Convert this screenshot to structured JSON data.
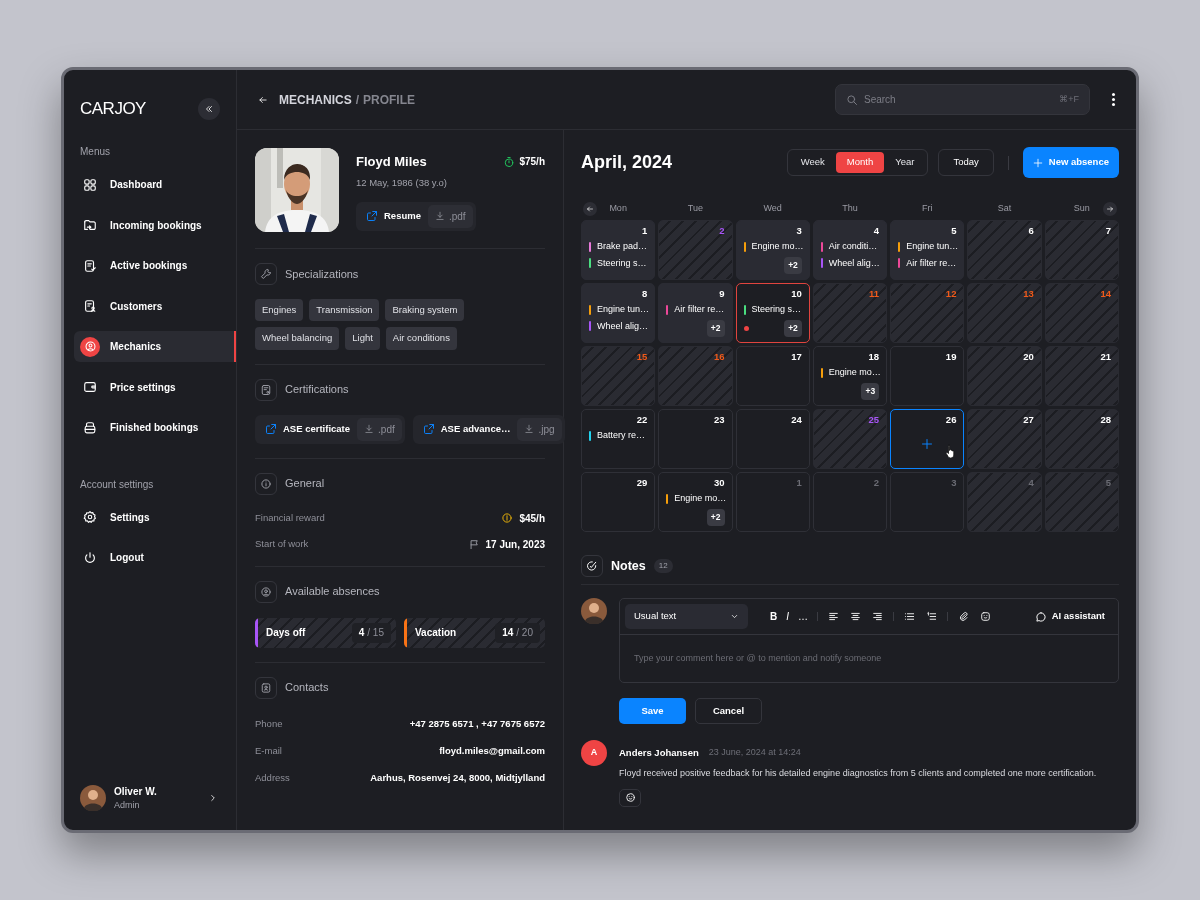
{
  "brand": "CARJOY",
  "sidebar": {
    "sections": [
      {
        "title": "Menus",
        "items": [
          {
            "label": "Dashboard",
            "selected": false
          },
          {
            "label": "Incoming bookings",
            "selected": false
          },
          {
            "label": "Active bookings",
            "selected": false
          },
          {
            "label": "Customers",
            "selected": false
          },
          {
            "label": "Mechanics",
            "selected": true
          },
          {
            "label": "Price settings",
            "selected": false
          },
          {
            "label": "Finished bookings",
            "selected": false
          }
        ]
      },
      {
        "title": "Account settings",
        "items": [
          {
            "label": "Settings",
            "selected": false
          },
          {
            "label": "Logout",
            "selected": false
          }
        ]
      }
    ],
    "user": {
      "name": "Oliver W.",
      "role": "Admin"
    }
  },
  "breadcrumb": {
    "parent": "MECHANICS",
    "separator": "/",
    "current": "PROFILE"
  },
  "search": {
    "placeholder": "Search",
    "shortcut": "⌘+F"
  },
  "profile": {
    "name": "Floyd Miles",
    "birth": "12 May, 1986 (38 y.o)",
    "rate": "$75/h",
    "resume": {
      "label": "Resume",
      "file": ".pdf"
    }
  },
  "specializations": {
    "title": "Specializations",
    "tags": [
      "Engines",
      "Transmission",
      "Braking system",
      "Wheel balancing",
      "Light",
      "Air conditions"
    ]
  },
  "certifications": {
    "title": "Certifications",
    "files": [
      {
        "label": "ASE certificate",
        "file": ".pdf"
      },
      {
        "label": "ASE advance…",
        "file": ".jpg"
      }
    ]
  },
  "general": {
    "title": "General",
    "rows": [
      {
        "kind": "reward",
        "label": "Financial reward",
        "value": "$45/h"
      },
      {
        "kind": "date",
        "label": "Start of work",
        "value": "17 Jun, 2023"
      }
    ]
  },
  "absences": {
    "title": "Available absences",
    "items": [
      {
        "label": "Days off",
        "used": "4",
        "total": "/ 15",
        "color": "#a855f7"
      },
      {
        "label": "Vacation",
        "used": "14",
        "total": "/ 20",
        "color": "#f97316"
      }
    ]
  },
  "contacts": {
    "title": "Contacts",
    "rows": [
      {
        "label": "Phone",
        "value": "+47 2875 6571 , +47 7675 6572"
      },
      {
        "label": "E-mail",
        "value": "floyd.miles@gmail.com"
      },
      {
        "label": "Address",
        "value": "Aarhus, Rosenvej 24, 8000, Midtjylland"
      }
    ]
  },
  "calendar": {
    "title": "April, 2024",
    "views": [
      {
        "label": "Week",
        "selected": false
      },
      {
        "label": "Month",
        "selected": true
      },
      {
        "label": "Year",
        "selected": false
      }
    ],
    "today": "Today",
    "new_button": "New absence",
    "weekdays": [
      "Mon",
      "Tue",
      "Wed",
      "Thu",
      "Fri",
      "Sat",
      "Sun"
    ],
    "days": [
      {
        "number": "1",
        "kind": "busy",
        "color": "#ffffff",
        "today": false,
        "hovered": false,
        "events": [
          {
            "title": "Brake pad…",
            "color": "#e879d9"
          },
          {
            "title": "Steering s…",
            "color": "#4ade80"
          }
        ]
      },
      {
        "number": "2",
        "kind": "off",
        "color": "#a855f7",
        "today": false,
        "hovered": false
      },
      {
        "number": "3",
        "kind": "busy",
        "color": "#ffffff",
        "today": false,
        "hovered": false,
        "events": [
          {
            "title": "Engine mo…",
            "color": "#f59e0b"
          }
        ],
        "more": "+2"
      },
      {
        "number": "4",
        "kind": "busy",
        "color": "#ffffff",
        "today": false,
        "hovered": false,
        "events": [
          {
            "title": "Air conditi…",
            "color": "#ec4899"
          },
          {
            "title": "Wheel alig…",
            "color": "#a855f7"
          }
        ]
      },
      {
        "number": "5",
        "kind": "busy",
        "color": "#ffffff",
        "today": false,
        "hovered": false,
        "events": [
          {
            "title": "Engine tun…",
            "color": "#f59e0b"
          },
          {
            "title": "Air filter re…",
            "color": "#ec4899"
          }
        ]
      },
      {
        "number": "6",
        "kind": "off",
        "color": "#ffffff",
        "today": false,
        "hovered": false
      },
      {
        "number": "7",
        "kind": "off",
        "color": "#ffffff",
        "today": false,
        "hovered": false
      },
      {
        "number": "8",
        "kind": "busy",
        "color": "#ffffff",
        "today": false,
        "hovered": false,
        "events": [
          {
            "title": "Engine tun…",
            "color": "#f59e0b"
          },
          {
            "title": "Wheel alig…",
            "color": "#a855f7"
          }
        ]
      },
      {
        "number": "9",
        "kind": "busy",
        "color": "#ffffff",
        "today": false,
        "hovered": false,
        "events": [
          {
            "title": "Air filter re…",
            "color": "#ec4899"
          }
        ],
        "more": "+2"
      },
      {
        "number": "10",
        "kind": "free",
        "color": "#ffffff",
        "today": true,
        "hovered": false,
        "events": [
          {
            "title": "Steering s…",
            "color": "#4ade80"
          }
        ],
        "more": "+2"
      },
      {
        "number": "11",
        "kind": "off",
        "color": "#f05a1a",
        "today": false,
        "hovered": false
      },
      {
        "number": "12",
        "kind": "off",
        "color": "#f05a1a",
        "today": false,
        "hovered": false
      },
      {
        "number": "13",
        "kind": "off",
        "color": "#f05a1a",
        "today": false,
        "hovered": false
      },
      {
        "number": "14",
        "kind": "off",
        "color": "#f05a1a",
        "today": false,
        "hovered": false
      },
      {
        "number": "15",
        "kind": "off",
        "color": "#f05a1a",
        "today": false,
        "hovered": false
      },
      {
        "number": "16",
        "kind": "off",
        "color": "#f05a1a",
        "today": false,
        "hovered": false
      },
      {
        "number": "17",
        "kind": "free",
        "color": "#ffffff",
        "today": false,
        "hovered": false
      },
      {
        "number": "18",
        "kind": "free",
        "color": "#ffffff",
        "today": false,
        "hovered": false,
        "events": [
          {
            "title": "Engine mo…",
            "color": "#f59e0b"
          }
        ],
        "more": "+3"
      },
      {
        "number": "19",
        "kind": "free",
        "color": "#ffffff",
        "today": false,
        "hovered": false
      },
      {
        "number": "20",
        "kind": "off",
        "color": "#ffffff",
        "today": false,
        "hovered": false
      },
      {
        "number": "21",
        "kind": "off",
        "color": "#ffffff",
        "today": false,
        "hovered": false
      },
      {
        "number": "22",
        "kind": "free",
        "color": "#ffffff",
        "today": false,
        "hovered": false,
        "events": [
          {
            "title": "Battery re…",
            "color": "#22d3ee"
          }
        ]
      },
      {
        "number": "23",
        "kind": "free",
        "color": "#ffffff",
        "today": false,
        "hovered": false
      },
      {
        "number": "24",
        "kind": "free",
        "color": "#ffffff",
        "today": false,
        "hovered": false
      },
      {
        "number": "25",
        "kind": "off",
        "color": "#a855f7",
        "today": false,
        "hovered": false
      },
      {
        "number": "26",
        "kind": "free",
        "color": "#ffffff",
        "today": false,
        "hovered": true
      },
      {
        "number": "27",
        "kind": "off",
        "color": "#ffffff",
        "today": false,
        "hovered": false
      },
      {
        "number": "28",
        "kind": "off",
        "color": "#ffffff",
        "today": false,
        "hovered": false
      },
      {
        "number": "29",
        "kind": "free",
        "color": "#ffffff",
        "today": false,
        "hovered": false
      },
      {
        "number": "30",
        "kind": "free",
        "color": "#ffffff",
        "today": false,
        "hovered": false,
        "events": [
          {
            "title": "Engine mo…",
            "color": "#f59e0b"
          }
        ],
        "more": "+2"
      },
      {
        "number": "1",
        "kind": "free",
        "color": "#6b6c74",
        "today": false,
        "hovered": false
      },
      {
        "number": "2",
        "kind": "free",
        "color": "#6b6c74",
        "today": false,
        "hovered": false
      },
      {
        "number": "3",
        "kind": "free",
        "color": "#6b6c74",
        "today": false,
        "hovered": false
      },
      {
        "number": "4",
        "kind": "off",
        "color": "#6b6c74",
        "today": false,
        "hovered": false
      },
      {
        "number": "5",
        "kind": "off",
        "color": "#6b6c74",
        "today": false,
        "hovered": false
      }
    ]
  },
  "notes": {
    "title": "Notes",
    "count": "12",
    "format": "Usual text",
    "marks": [
      "B",
      "I",
      "…"
    ],
    "assistant": "AI assistant",
    "placeholder": "Type your comment here or @ to mention and notify someone",
    "save": "Save",
    "cancel": "Cancel",
    "comments": [
      {
        "initial": "A",
        "author": "Anders Johansen",
        "time": "23 June, 2024 at 14:24",
        "text": "Floyd received positive feedback for his detailed engine diagnostics from 5 clients and completed one more certification."
      }
    ]
  }
}
